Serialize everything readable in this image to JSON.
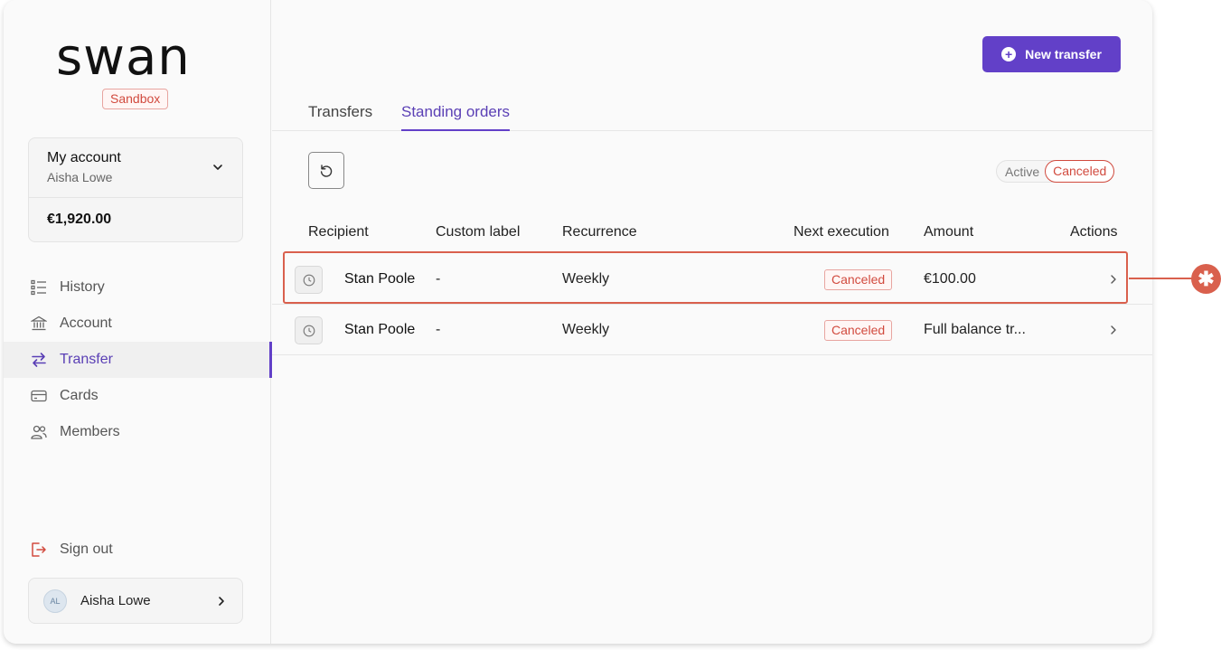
{
  "brand": {
    "logo_text": "swan",
    "environment": "Sandbox"
  },
  "account": {
    "title": "My account",
    "owner": "Aisha Lowe",
    "balance": "€1,920.00"
  },
  "nav": {
    "items": [
      {
        "label": "History",
        "icon": "list-icon"
      },
      {
        "label": "Account",
        "icon": "bank-icon"
      },
      {
        "label": "Transfer",
        "icon": "transfer-arrows-icon",
        "active": true
      },
      {
        "label": "Cards",
        "icon": "card-icon"
      },
      {
        "label": "Members",
        "icon": "people-icon"
      }
    ],
    "sign_out": "Sign out"
  },
  "user": {
    "initials": "AL",
    "name": "Aisha Lowe"
  },
  "header": {
    "new_transfer_label": "New transfer"
  },
  "tabs": [
    {
      "label": "Transfers",
      "active": false
    },
    {
      "label": "Standing orders",
      "active": true
    }
  ],
  "filter": {
    "options": [
      "Active",
      "Canceled"
    ],
    "selected": "Canceled"
  },
  "table": {
    "columns": [
      "Recipient",
      "Custom label",
      "Recurrence",
      "Next execution",
      "Amount",
      "Actions"
    ],
    "rows": [
      {
        "recipient": "Stan Poole",
        "custom_label": "-",
        "recurrence": "Weekly",
        "status": "Canceled",
        "amount": "€100.00"
      },
      {
        "recipient": "Stan Poole",
        "custom_label": "-",
        "recurrence": "Weekly",
        "status": "Canceled",
        "amount": "Full balance tr..."
      }
    ]
  },
  "annotation": {
    "marker": "✱"
  },
  "colors": {
    "accent": "#6240c8",
    "danger": "#d14a3e",
    "highlight": "#d9604d"
  }
}
